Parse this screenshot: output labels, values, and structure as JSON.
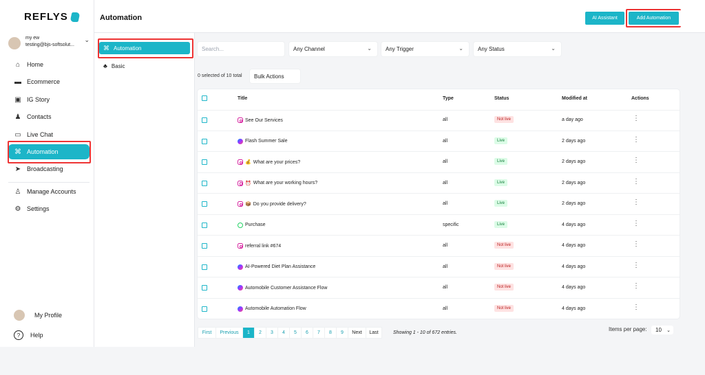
{
  "brand": {
    "name": "REFLYS",
    "accent": "#1cb5c8"
  },
  "user": {
    "name": "my ew",
    "email": "testing@bjs-softsolut..."
  },
  "nav": [
    {
      "label": "Home",
      "icon": "home-icon"
    },
    {
      "label": "Ecommerce",
      "icon": "store-icon"
    },
    {
      "label": "IG Story",
      "icon": "image-icon"
    },
    {
      "label": "Contacts",
      "icon": "users-icon"
    },
    {
      "label": "Live Chat",
      "icon": "chat-icon"
    },
    {
      "label": "Automation",
      "icon": "automation-icon",
      "active": true
    },
    {
      "label": "Broadcasting",
      "icon": "send-icon"
    },
    {
      "label": "Manage Accounts",
      "icon": "user-cog-icon"
    },
    {
      "label": "Settings",
      "icon": "gear-icon"
    }
  ],
  "bottom": {
    "profile": "My Profile",
    "help": "Help"
  },
  "header": {
    "title": "Automation",
    "ai_label": "AI Assistant",
    "add_label": "Add Automation"
  },
  "subnav": [
    {
      "label": "Automation",
      "icon": "automation-icon",
      "active": true
    },
    {
      "label": "Basic",
      "icon": "sitemap-icon"
    }
  ],
  "filters": {
    "search_placeholder": "Search...",
    "channel": "Any Channel",
    "trigger": "Any Trigger",
    "status": "Any Status"
  },
  "selection": {
    "info": "0 selected of 10 total",
    "bulk": "Bulk Actions"
  },
  "table": {
    "headers": {
      "title": "Title",
      "type": "Type",
      "status": "Status",
      "modified": "Modified at",
      "actions": "Actions"
    },
    "rows": [
      {
        "channel": "instagram",
        "emoji": "",
        "title": "See Our Services",
        "type": "all",
        "status": "Not live",
        "modified": "a day ago"
      },
      {
        "channel": "messenger",
        "emoji": "",
        "title": "Flash Summer Sale",
        "type": "all",
        "status": "Live",
        "modified": "2 days ago"
      },
      {
        "channel": "instagram",
        "emoji": "💰",
        "title": "What are your prices?",
        "type": "all",
        "status": "Live",
        "modified": "2 days ago"
      },
      {
        "channel": "instagram",
        "emoji": "⏰",
        "title": "What are your working hours?",
        "type": "all",
        "status": "Live",
        "modified": "2 days ago"
      },
      {
        "channel": "instagram",
        "emoji": "📦",
        "title": "Do you provide delivery?",
        "type": "all",
        "status": "Live",
        "modified": "2 days ago"
      },
      {
        "channel": "whatsapp",
        "emoji": "",
        "title": "Purchase",
        "type": "specific",
        "status": "Live",
        "modified": "4 days ago"
      },
      {
        "channel": "instagram",
        "emoji": "",
        "title": "referral link #674",
        "type": "all",
        "status": "Not live",
        "modified": "4 days ago"
      },
      {
        "channel": "messenger",
        "emoji": "",
        "title": "AI-Powered Diet Plan Assistance",
        "type": "all",
        "status": "Not live",
        "modified": "4 days ago"
      },
      {
        "channel": "messenger",
        "emoji": "",
        "title": "Automobile Customer Assistance Flow",
        "type": "all",
        "status": "Not live",
        "modified": "4 days ago"
      },
      {
        "channel": "messenger",
        "emoji": "",
        "title": "Automobile Automation Flow",
        "type": "all",
        "status": "Not live",
        "modified": "4 days ago"
      }
    ]
  },
  "pagination": {
    "first": "First",
    "previous": "Previous",
    "pages": [
      "1",
      "2",
      "3",
      "4",
      "5",
      "6",
      "7",
      "8",
      "9"
    ],
    "current": "1",
    "next": "Next",
    "last": "Last",
    "showing": "Showing 1 - 10 of 672 entries."
  },
  "items_per_page": {
    "label": "Items per page:",
    "value": "10"
  }
}
